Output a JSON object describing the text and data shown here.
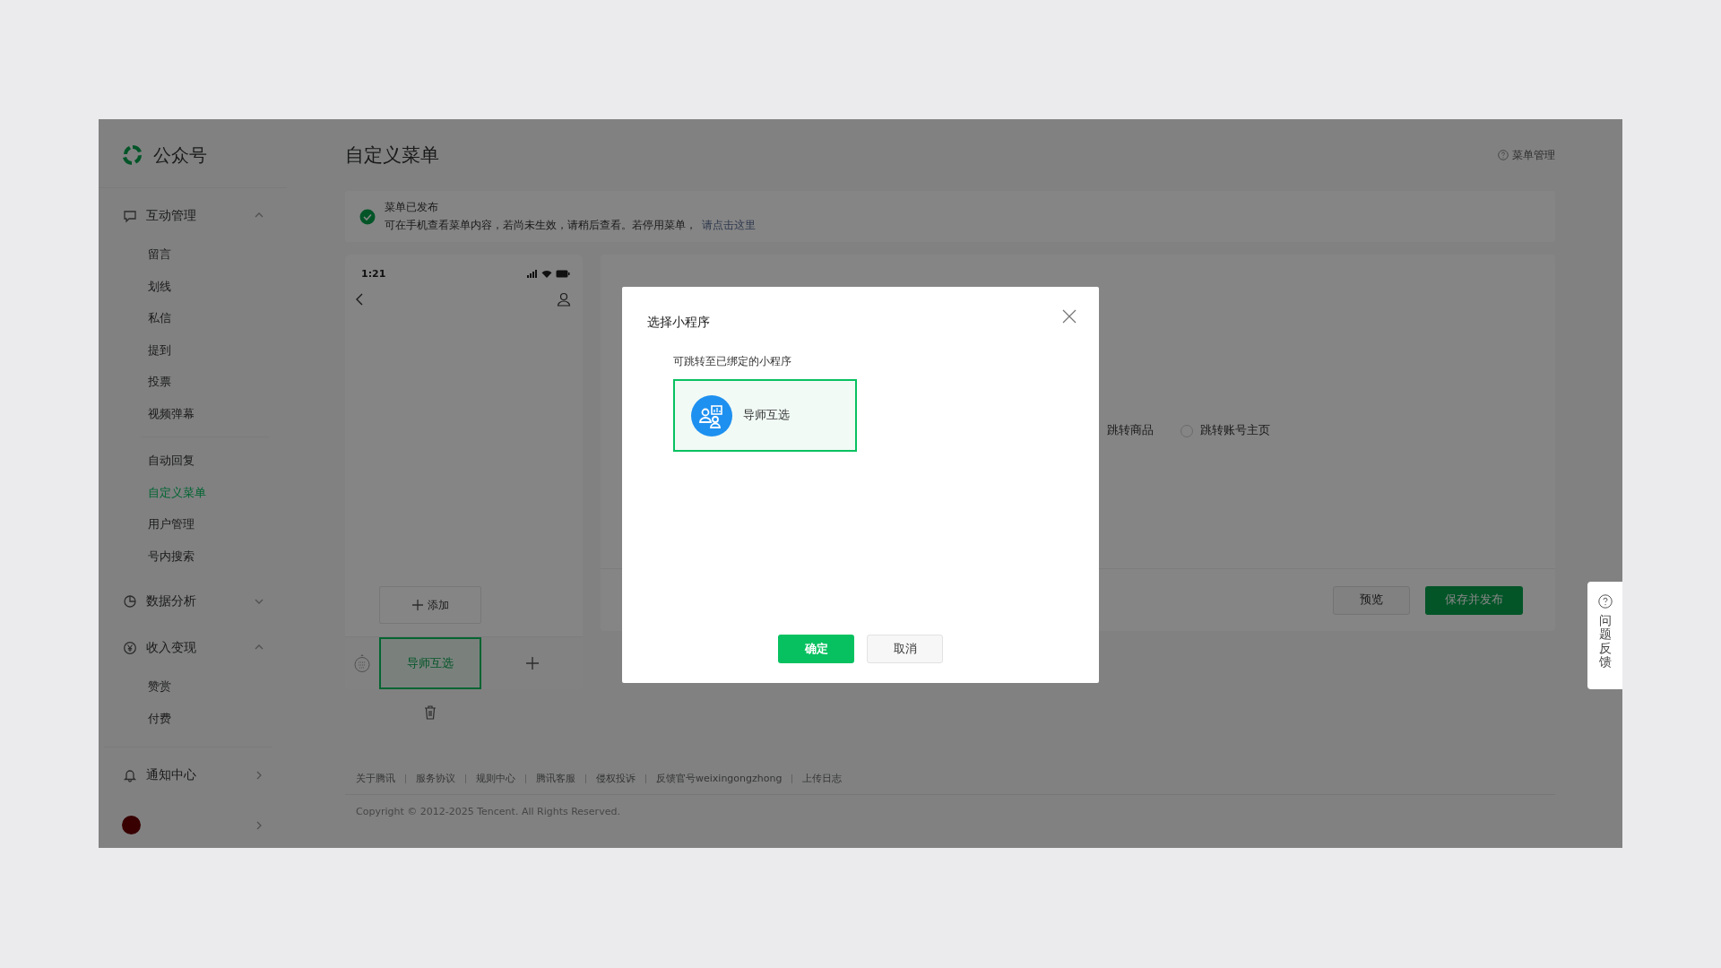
{
  "sidebar": {
    "logo": "公众号",
    "sections": [
      {
        "label": "互动管理",
        "kind": "group",
        "expanded": true,
        "groups": [
          [
            {
              "label": "留言",
              "selected": false
            },
            {
              "label": "划线",
              "selected": false
            },
            {
              "label": "私信",
              "selected": false
            },
            {
              "label": "提到",
              "selected": false
            },
            {
              "label": "投票",
              "selected": false
            },
            {
              "label": "视频弹幕",
              "selected": false
            }
          ],
          [
            {
              "label": "自动回复",
              "selected": false
            },
            {
              "label": "自定义菜单",
              "selected": true
            },
            {
              "label": "用户管理",
              "selected": false
            },
            {
              "label": "号内搜索",
              "selected": false
            }
          ]
        ]
      },
      {
        "label": "数据分析",
        "kind": "group",
        "expanded": false
      },
      {
        "label": "收入变现",
        "kind": "group",
        "expanded": true,
        "groups": [
          [
            {
              "label": "赞赏",
              "selected": false
            },
            {
              "label": "付费",
              "selected": false
            }
          ]
        ]
      },
      {
        "label": "通知中心",
        "kind": "link"
      }
    ]
  },
  "main": {
    "title": "自定义菜单",
    "help_link": "菜单管理",
    "notice": {
      "title": "菜单已发布",
      "text": "可在手机查看菜单内容，若尚未生效，请稍后查看。若停用菜单，",
      "link": "请点击这里"
    },
    "phone": {
      "time": "1:21",
      "add_label": "添加",
      "menus": [
        {
          "label": "导师互选",
          "selected": true
        }
      ]
    },
    "editor": {
      "options": [
        {
          "label": "跳转商品",
          "kind": "label"
        },
        {
          "label": "跳转账号主页",
          "kind": "radio",
          "selected": false
        }
      ],
      "buttons": [
        {
          "label": "预览",
          "kind": "default"
        },
        {
          "label": "保存并发布",
          "kind": "primary"
        }
      ]
    },
    "footer": {
      "links": [
        "关于腾讯",
        "服务协议",
        "规则中心",
        "腾讯客服",
        "侵权投诉",
        "反馈官号weixingongzhong",
        "上传日志"
      ],
      "copyright": "Copyright © 2012-2025 Tencent. All Rights Reserved."
    }
  },
  "modal": {
    "title": "选择小程序",
    "subtitle": "可跳转至已绑定的小程序",
    "programs": [
      {
        "name": "导师互选",
        "selected": true
      }
    ],
    "buttons": [
      {
        "label": "确定",
        "kind": "primary"
      },
      {
        "label": "取消",
        "kind": "default"
      }
    ]
  },
  "feedback": {
    "label": "问题反馈"
  }
}
